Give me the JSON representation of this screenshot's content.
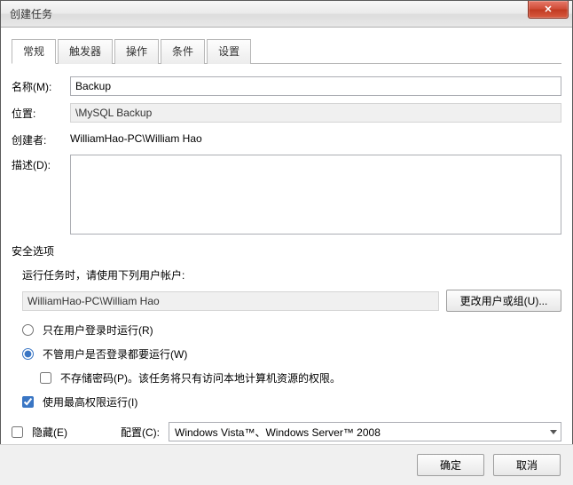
{
  "window": {
    "title": "创建任务",
    "close_glyph": "✕"
  },
  "tabs": {
    "general": "常规",
    "triggers": "触发器",
    "actions": "操作",
    "conditions": "条件",
    "settings": "设置"
  },
  "labels": {
    "name": "名称(M):",
    "location": "位置:",
    "author": "创建者:",
    "description": "描述(D):"
  },
  "values": {
    "name": "Backup",
    "location": "\\MySQL Backup",
    "author": "WilliamHao-PC\\William Hao",
    "description": ""
  },
  "security": {
    "group_label": "安全选项",
    "prompt": "运行任务时，请使用下列用户帐户:",
    "user": "WilliamHao-PC\\William Hao",
    "change_user_btn": "更改用户或组(U)...",
    "radio_logged_on": "只在用户登录时运行(R)",
    "radio_any": "不管用户是否登录都要运行(W)",
    "no_store_pw": "不存储密码(P)。该任务将只有访问本地计算机资源的权限。",
    "highest_priv": "使用最高权限运行(I)"
  },
  "bottom": {
    "hidden": "隐藏(E)",
    "config_label": "配置(C):",
    "config_value": "Windows Vista™、Windows Server™ 2008"
  },
  "footer": {
    "ok": "确定",
    "cancel": "取消"
  }
}
